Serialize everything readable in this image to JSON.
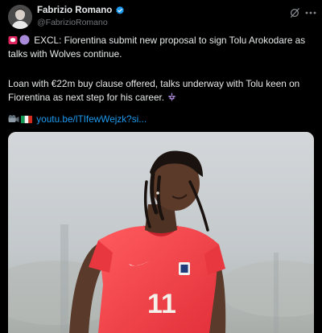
{
  "author": {
    "display_name": "Fabrizio Romano",
    "handle": "@FabrizioRomano"
  },
  "tweet": {
    "line1": "EXCL: Fiorentina submit new proposal to sign Tolu Arokodare as talks with Wolves continue.",
    "line2": "Loan with €22m buy clause offered, talks underway with Tolu keen on Fiorentina as next step for his career.",
    "link": "youtu.be/lTIfewWejzk?si..."
  },
  "media": {
    "jersey_number": "11"
  },
  "icons": [
    "verified-icon",
    "grok-icon",
    "more-icon",
    "red-badge-icon",
    "purple-circle-icon",
    "fleur-de-lis-icon",
    "camera-icon",
    "italy-flag-icon"
  ],
  "colors": {
    "background": "#000000",
    "text": "#e7e9ea",
    "muted": "#71767b",
    "link": "#1d9bf0",
    "verified": "#1d9bf0"
  }
}
